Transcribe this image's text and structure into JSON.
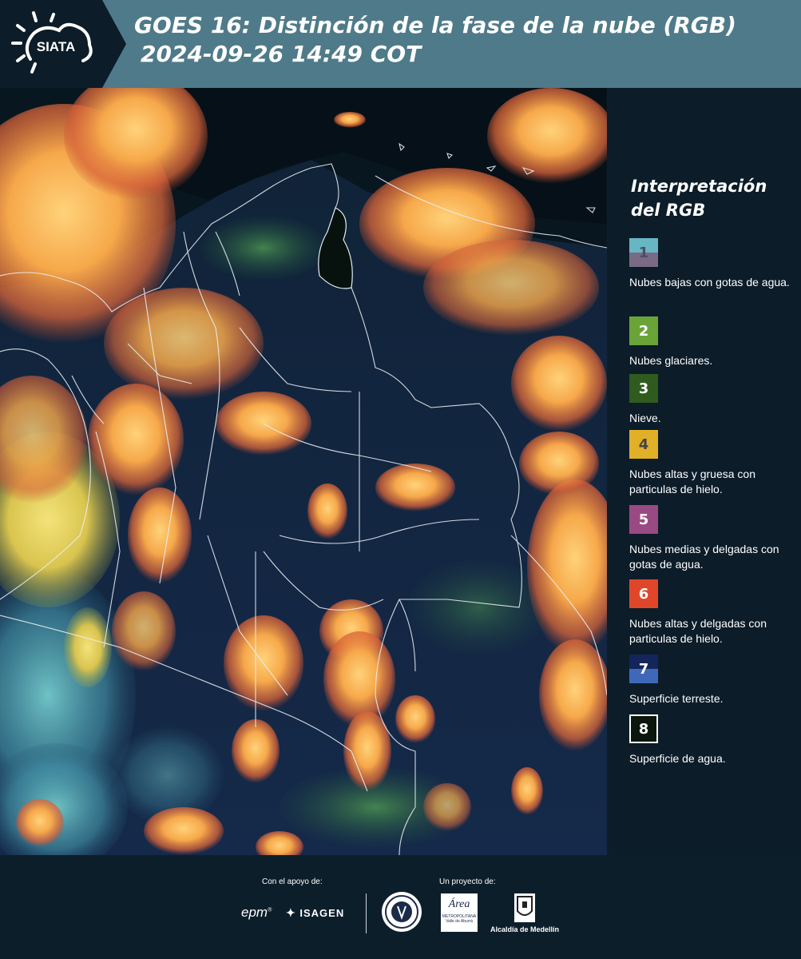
{
  "header": {
    "logo_text": "SIATA",
    "title_line1": "GOES 16: Distinción de la fase de la nube (RGB)",
    "title_line2": "2024-09-26 14:49 COT"
  },
  "legend": {
    "title": "Interpretación del RGB",
    "items": [
      {
        "num": "1",
        "label": "Nubes bajas con gotas de agua.",
        "top_color": "#66b6c4",
        "bottom_color": "#7a6a86",
        "num_color": "#4e4e63"
      },
      {
        "num": "2",
        "label": "Nubes glaciares.",
        "top_color": "#6aa337",
        "bottom_color": "#6aa337",
        "num_color": "#ffffff"
      },
      {
        "num": "3",
        "label": "Nieve.",
        "top_color": "#2f5c1e",
        "bottom_color": "#2f5c1e",
        "num_color": "#ffffff"
      },
      {
        "num": "4",
        "label": "Nubes altas y gruesa con particulas de hielo.",
        "top_color": "#e0b028",
        "bottom_color": "#e0b028",
        "num_color": "#444444"
      },
      {
        "num": "5",
        "label": "Nubes medias y delgadas con gotas de agua.",
        "top_color": "#9a4a82",
        "bottom_color": "#9a4a82",
        "num_color": "#ffffff"
      },
      {
        "num": "6",
        "label": "Nubes altas y delgadas con particulas de hielo.",
        "top_color": "#e0472a",
        "bottom_color": "#e0472a",
        "num_color": "#ffffff"
      },
      {
        "num": "7",
        "label": "Superficie terreste.",
        "top_color": "#14255c",
        "bottom_color": "#3f68b8",
        "num_color": "#ffffff"
      },
      {
        "num": "8",
        "label": "Superficie de agua.",
        "top_color": "#0b160d",
        "bottom_color": "#0b160d",
        "num_color": "#ffffff"
      }
    ]
  },
  "footer": {
    "support_label": "Con el apoyo de:",
    "project_label": "Un proyecto de:",
    "logo_epm": "epm",
    "logo_isagen": "ISAGEN",
    "logo_area": "Área",
    "logo_area_sub1": "METROPOLITANA",
    "logo_area_sub2": "Valle de Aburrá",
    "logo_alcaldia": "Alcaldía de Medellín"
  },
  "colors": {
    "header_bg": "#4f7a89",
    "panel_bg": "#0c1c29",
    "cloud_orange": "#f0a040",
    "land_blue": "#13294a"
  }
}
